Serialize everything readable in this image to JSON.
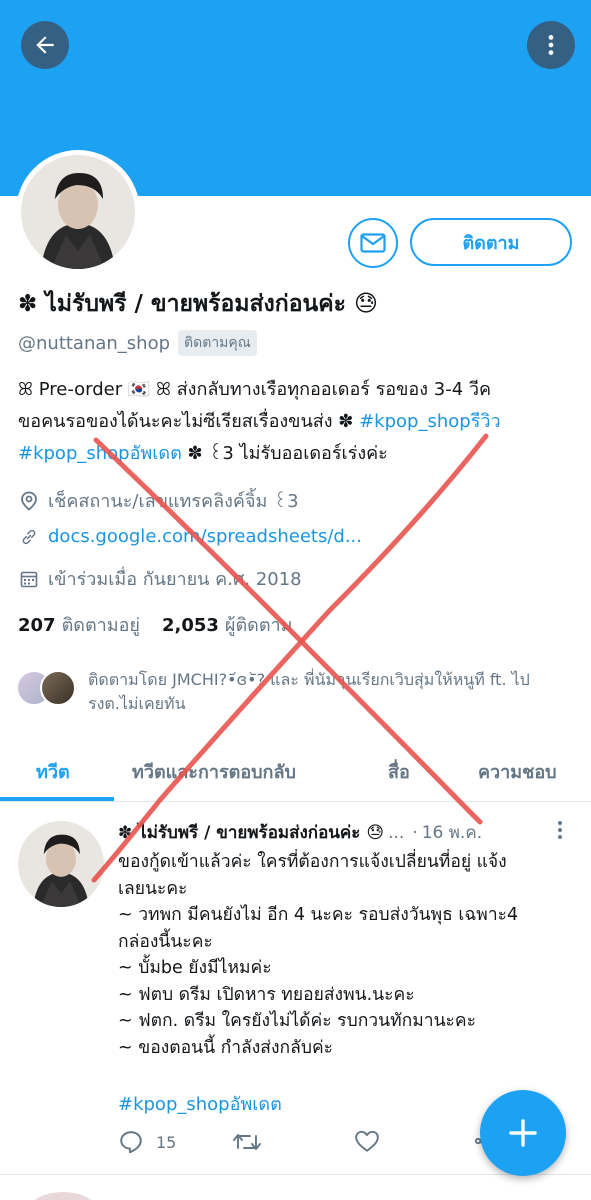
{
  "header": {
    "back_icon": "arrow-left-icon",
    "more_icon": "vertical-dots-icon",
    "banner_color": "#1da1f2"
  },
  "profile": {
    "display_name": "✽ ไม่รับพรี / ขายพร้อมส่งก่อนค่ะ 😓",
    "handle": "@nuttanan_shop",
    "follows_you": "ติดตามคุณ",
    "follow_label": "ติดตาม",
    "message_icon": "envelope-icon",
    "bio_lines": [
      "ꕤ Pre-order 🇰🇷 ꕤ ส่งกลับทางเรือทุกออเดอร์ รอของ 3-4 วีค",
      "ขอคนรอของได้นะคะไม่ซีเรียสเรื่องขนส่ง ✽ ",
      " ✽ ꒰3 ไม่รับออเดอร์เร่งค่ะ"
    ],
    "bio_tags": [
      "#kpop_shopรีวิว",
      "#kpop_shopอัพเดต"
    ],
    "location": "เช็คสถานะ/เลขแทรคลิงค์จิ้ม ꒰3",
    "website": "docs.google.com/spreadsheets/d...",
    "joined": "เข้าร่วมเมื่อ กันยายน ค.ศ. 2018",
    "following_count": "207",
    "following_label": "ติดตามอยู่",
    "followers_count": "2,053",
    "followers_label": "ผู้ติดตาม",
    "followed_by": "ติดตามโดย JMCHI?•᷄ɞ•᷅? และ พี่นัมจุนเรียกเวิบสุ่มให้หนูที ft. ไปรงต.ไม่เคยทัน"
  },
  "tabs": [
    {
      "label": "ทวีต",
      "active": true
    },
    {
      "label": "ทวีตและการตอบกลับ",
      "active": false
    },
    {
      "label": "สื่อ",
      "active": false
    },
    {
      "label": "ความชอบ",
      "active": false
    }
  ],
  "tweet": {
    "name": "✽ ไม่รับพรี / ขายพร้อมส่งก่อนค่ะ 😓",
    "ellipsis": "...",
    "separator": "·",
    "date": "16 พ.ค.",
    "body_lines": [
      "ของกู้ดเข้าแล้วค่ะ ใครที่ต้องการแจ้งเปลี่ยนที่อยู่ แจ้ง",
      "เลยนะคะ",
      "~ วทพก มีคนยังไม่ อีก 4 นะคะ รอบส่งวันพุธ เฉพาะ4",
      "กล่องนี้นะคะ",
      "~ บั้มbe ยังมีไหมค่ะ",
      "~ ฟตบ ดรีม เปิดหาร ทยอยส่งพน.นะคะ",
      "~ ฟตก. ดรีม ใครยังไม่ได้ค่ะ รบกวนทักมานะคะ",
      "~ ของตอนนี้ กำลังส่งกลับค่ะ"
    ],
    "hashtag": "#kpop_shopอัพเดต",
    "reply_count": "15",
    "reply_icon": "comment-icon",
    "retweet_icon": "retweet-icon",
    "like_icon": "heart-icon",
    "share_icon": "share-icon"
  },
  "fab": {
    "icon": "plus-icon"
  },
  "colors": {
    "accent": "#1da1f2",
    "link": "#1b95e0",
    "muted": "#657786",
    "cross": "#e8534f"
  }
}
